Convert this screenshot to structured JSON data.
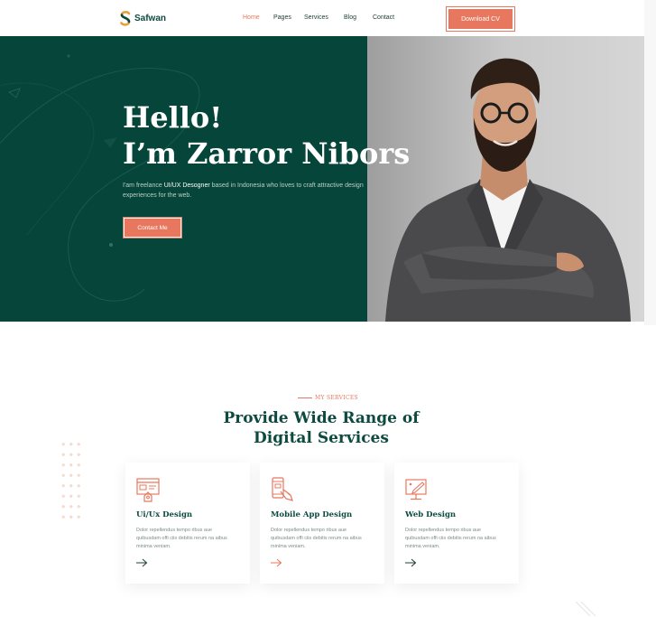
{
  "brand": {
    "name": "Safwan",
    "accent": "#e8775f",
    "dark": "#064539"
  },
  "nav": {
    "items": [
      {
        "label": "Home",
        "active": true
      },
      {
        "label": "Pages",
        "active": false
      },
      {
        "label": "Services",
        "active": false
      },
      {
        "label": "Blog",
        "active": false
      },
      {
        "label": "Contact",
        "active": false
      }
    ],
    "cta": "Download CV"
  },
  "hero": {
    "greeting": "Hello!",
    "name": "I’m Zarror Nibors",
    "subtitle_pre": "I'am freelance ",
    "subtitle_role": "UI/UX Desogner",
    "subtitle_post": " based in Indonesia who loves to craft attractive design experiences for the web.",
    "cta": "Contact Me"
  },
  "services": {
    "eyebrow": "MY SERVICES",
    "title_line1": "Provide Wide Range of",
    "title_line2": "Digital Services",
    "cards": [
      {
        "title": "Ui/Ux Design",
        "desc": "Dolor repellendus tempo ribus aue quibusdam offi ciis debitis rerum na aibus minima veniam.",
        "icon": "web-design-icon"
      },
      {
        "title": "Mobile App Design",
        "desc": "Dolor repellendus tempo ribus aue quibusdam offi ciis debitis rerum na aibus minima veniam.",
        "icon": "mobile-design-icon"
      },
      {
        "title": "Web Design",
        "desc": "Dolor repellendus tempo ribus aue quibusdam offi ciis debitis rerum na aibus minima veniam.",
        "icon": "monitor-design-icon"
      }
    ]
  }
}
